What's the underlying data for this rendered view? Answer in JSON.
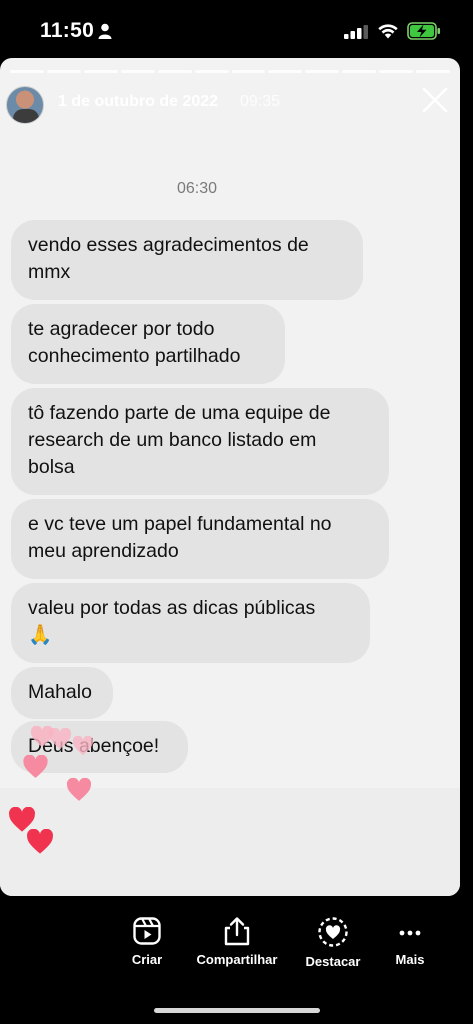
{
  "status_bar": {
    "time": "11:50",
    "icons": [
      "person-icon",
      "signal-icon",
      "wifi-icon",
      "battery-charging-icon"
    ]
  },
  "story": {
    "date": "1 de outubro de 2022",
    "time": "09:35",
    "chat_timestamp": "06:30",
    "messages": [
      "vendo esses agradecimentos de\nmmx",
      "te agradecer por todo\nconhecimento partilhado",
      "tô fazendo parte de uma equipe de\nresearch de um banco listado em\nbolsa",
      "e vc teve um papel fundamental no\nmeu aprendizado",
      "valeu por todas as dicas públicas\n🙏",
      "Mahalo",
      "Deus abençoe!"
    ],
    "colors": {
      "bubble": "#e3e3e3",
      "background": "#f2f2f2",
      "heart": "#f0344f",
      "heart_light": "#f58aa0"
    }
  },
  "toolbar": {
    "create_label": "Criar",
    "share_label": "Compartilhar",
    "highlight_label": "Destacar",
    "more_label": "Mais"
  }
}
